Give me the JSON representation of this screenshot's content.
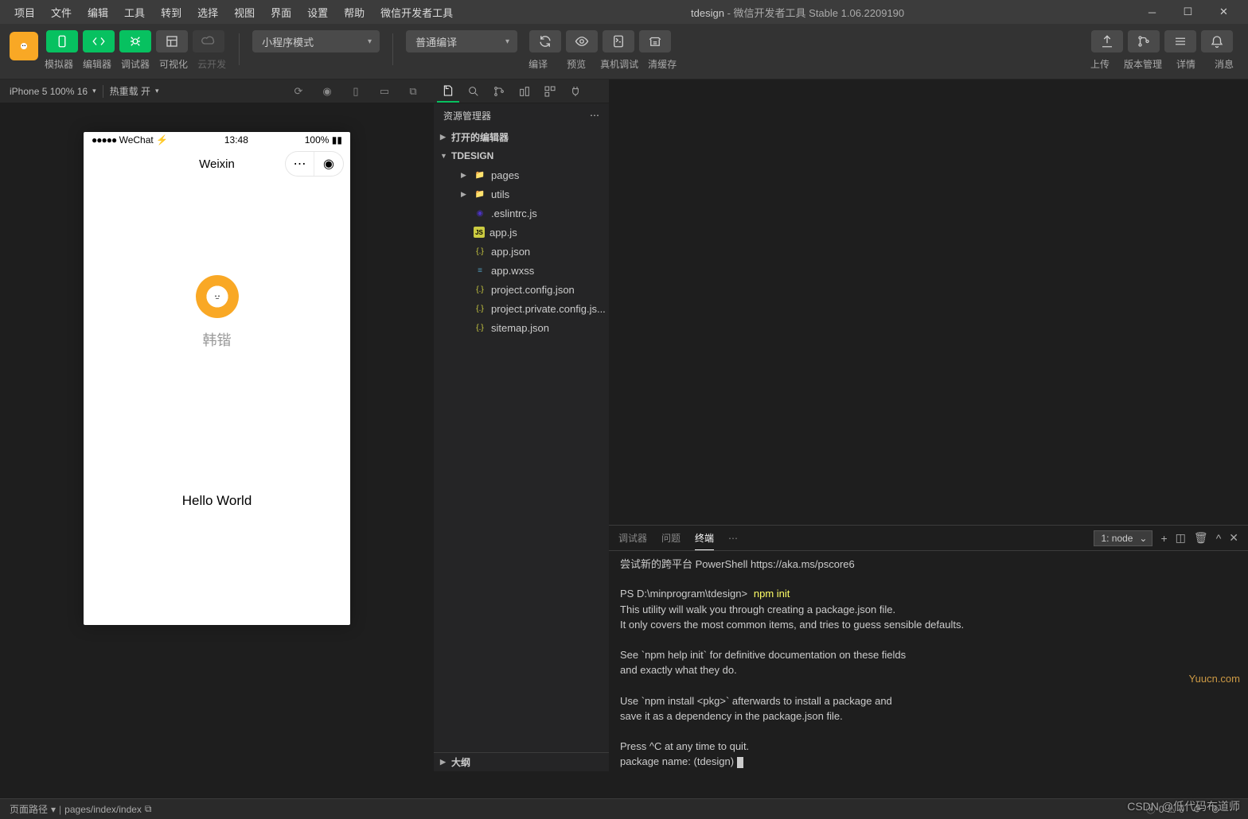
{
  "titlebar": {
    "menus": [
      "项目",
      "文件",
      "编辑",
      "工具",
      "转到",
      "选择",
      "视图",
      "界面",
      "设置",
      "帮助",
      "微信开发者工具"
    ],
    "project": "tdesign",
    "app_title": "微信开发者工具 Stable 1.06.2209190"
  },
  "toolbar": {
    "labels": {
      "simulator": "模拟器",
      "editor": "编辑器",
      "debugger": "调试器",
      "visualize": "可视化",
      "cloud": "云开发"
    },
    "mode_select": "小程序模式",
    "compile_select": "普通编译",
    "actions": {
      "compile": "编译",
      "preview": "预览",
      "realdevice": "真机调试",
      "clearcache": "清缓存"
    },
    "right": {
      "upload": "上传",
      "version": "版本管理",
      "detail": "详情",
      "message": "消息"
    }
  },
  "device_bar": {
    "device": "iPhone 5 100% 16",
    "hotreload": "热重载 开"
  },
  "phone": {
    "carrier": "WeChat",
    "time": "13:48",
    "battery": "100%",
    "title": "Weixin",
    "username": "韩锴",
    "hello": "Hello World"
  },
  "explorer": {
    "title": "资源管理器",
    "sections": {
      "open_editors": "打开的编辑器",
      "project": "TDESIGN",
      "outline": "大纲"
    },
    "tree": [
      {
        "name": "pages",
        "type": "folder",
        "depth": 1
      },
      {
        "name": "utils",
        "type": "folder",
        "depth": 1
      },
      {
        "name": ".eslintrc.js",
        "type": "eslint",
        "depth": 1
      },
      {
        "name": "app.js",
        "type": "js",
        "depth": 1
      },
      {
        "name": "app.json",
        "type": "json",
        "depth": 1
      },
      {
        "name": "app.wxss",
        "type": "wxss",
        "depth": 1
      },
      {
        "name": "project.config.json",
        "type": "json",
        "depth": 1
      },
      {
        "name": "project.private.config.js...",
        "type": "json",
        "depth": 1
      },
      {
        "name": "sitemap.json",
        "type": "json",
        "depth": 1
      }
    ]
  },
  "terminal": {
    "tabs": {
      "debugger": "调试器",
      "problems": "问题",
      "terminal": "终端"
    },
    "select": "1: node",
    "line1": "尝试新的跨平台 PowerShell https://aka.ms/pscore6",
    "prompt": "PS D:\\minprogram\\tdesign>",
    "cmd": "npm init",
    "body": "This utility will walk you through creating a package.json file.\nIt only covers the most common items, and tries to guess sensible defaults.\n\nSee `npm help init` for definitive documentation on these fields\nand exactly what they do.\n\nUse `npm install <pkg>` afterwards to install a package and\nsave it as a dependency in the package.json file.\n\nPress ^C at any time to quit.\npackage name: (tdesign)"
  },
  "status": {
    "path_label": "页面路径",
    "path": "pages/index/index",
    "errors": "0",
    "warnings": "0"
  },
  "watermark": {
    "csdn": "CSDN @低代码布道师",
    "yuucn": "Yuucn.com"
  }
}
